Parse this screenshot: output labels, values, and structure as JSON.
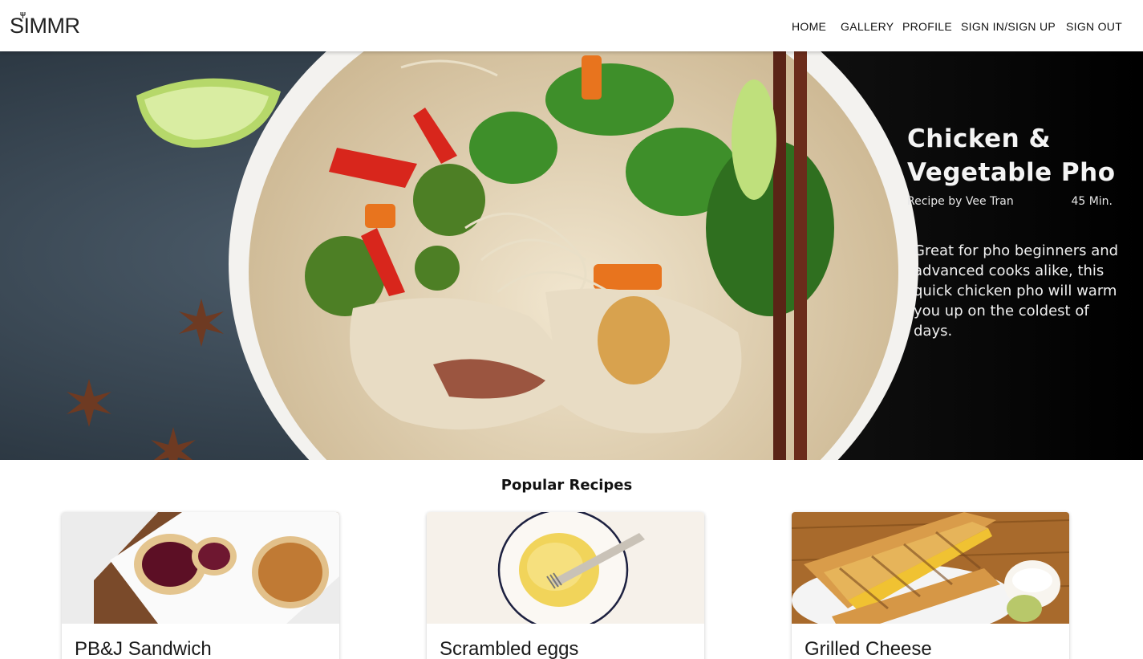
{
  "header": {
    "logo_text": "SIMMR",
    "nav": [
      "HOME",
      "GALLERY",
      "PROFILE",
      "SIGN IN/SIGN UP",
      "SIGN OUT"
    ]
  },
  "hero": {
    "title": "Chicken & Vegetable Pho",
    "author": "Recipe by Vee Tran",
    "time": "45 Min.",
    "description": "Great for pho beginners and advanced cooks alike, this quick chicken pho will warm you up on the coldest of days."
  },
  "popular": {
    "title": "Popular Recipes",
    "recipes": [
      {
        "name": "PB&J Sandwich",
        "image": "pbj-sandwich-image"
      },
      {
        "name": "Scrambled eggs",
        "image": "scrambled-eggs-image"
      },
      {
        "name": "Grilled Cheese",
        "image": "grilled-cheese-image"
      }
    ]
  },
  "colors": {
    "hero_dark": "#0a0a0a",
    "slate": "#3b4a57",
    "text_light": "#f4f4f4"
  }
}
